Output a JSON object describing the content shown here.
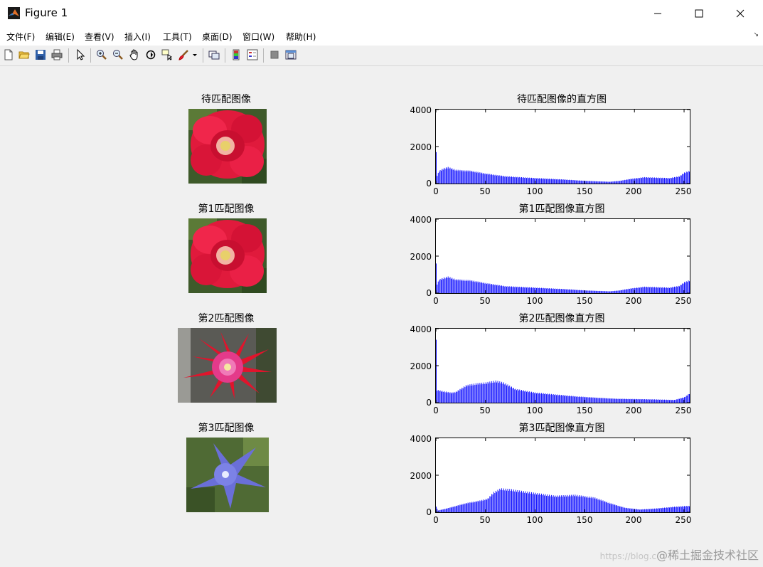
{
  "window": {
    "title": "Figure 1"
  },
  "menu": [
    "文件(F)",
    "编辑(E)",
    "查看(V)",
    "插入(I)",
    "工具(T)",
    "桌面(D)",
    "窗口(W)",
    "帮助(H)"
  ],
  "toolbar": [
    "new-figure-icon",
    "open-file-icon",
    "save-icon",
    "print-icon",
    "select-arrow-icon",
    "zoom-in-icon",
    "zoom-out-icon",
    "pan-hand-icon",
    "rotate-3d-icon",
    "data-cursor-icon",
    "brush-icon",
    "link-plot-icon",
    "colorbar-icon",
    "legend-icon",
    "hide-plot-tools-icon",
    "show-plot-tools-icon"
  ],
  "watermark": {
    "prefix": "https://blog.c",
    "text": "@稀土掘金技术社区"
  },
  "subplots": [
    {
      "image_title": "待匹配图像",
      "image_subject": "red-rose",
      "chart_data": {
        "type": "bar",
        "title": "待匹配图像的直方图",
        "xlabel": "",
        "ylabel": "",
        "xlim": [
          0,
          255
        ],
        "ylim": [
          0,
          4000
        ],
        "xticks": [
          0,
          50,
          100,
          150,
          200,
          250
        ],
        "yticks": [
          0,
          2000,
          4000
        ],
        "bar_color": "#0000ff",
        "profile": [
          [
            0,
            1700
          ],
          [
            1,
            450
          ],
          [
            3,
            700
          ],
          [
            8,
            850
          ],
          [
            12,
            900
          ],
          [
            20,
            750
          ],
          [
            35,
            700
          ],
          [
            50,
            550
          ],
          [
            70,
            400
          ],
          [
            100,
            300
          ],
          [
            130,
            220
          ],
          [
            150,
            150
          ],
          [
            175,
            100
          ],
          [
            185,
            150
          ],
          [
            195,
            250
          ],
          [
            210,
            350
          ],
          [
            235,
            300
          ],
          [
            245,
            400
          ],
          [
            250,
            600
          ],
          [
            255,
            700
          ]
        ]
      }
    },
    {
      "image_title": "第1匹配图像",
      "image_subject": "red-rose",
      "chart_data": {
        "type": "bar",
        "title": "第1匹配图像直方图",
        "xlabel": "",
        "ylabel": "",
        "xlim": [
          0,
          255
        ],
        "ylim": [
          0,
          4000
        ],
        "xticks": [
          0,
          50,
          100,
          150,
          200,
          250
        ],
        "yticks": [
          0,
          2000,
          4000
        ],
        "bar_color": "#0000ff",
        "profile": [
          [
            0,
            1600
          ],
          [
            1,
            500
          ],
          [
            3,
            750
          ],
          [
            8,
            850
          ],
          [
            12,
            900
          ],
          [
            20,
            750
          ],
          [
            35,
            700
          ],
          [
            50,
            550
          ],
          [
            70,
            380
          ],
          [
            100,
            300
          ],
          [
            130,
            220
          ],
          [
            150,
            150
          ],
          [
            175,
            100
          ],
          [
            185,
            150
          ],
          [
            195,
            250
          ],
          [
            210,
            350
          ],
          [
            235,
            300
          ],
          [
            245,
            400
          ],
          [
            250,
            600
          ],
          [
            255,
            700
          ]
        ]
      }
    },
    {
      "image_title": "第2匹配图像",
      "image_subject": "pink-cactus-flower",
      "chart_data": {
        "type": "bar",
        "title": "第2匹配图像直方图",
        "xlabel": "",
        "ylabel": "",
        "xlim": [
          0,
          255
        ],
        "ylim": [
          0,
          4000
        ],
        "xticks": [
          0,
          50,
          100,
          150,
          200,
          250
        ],
        "yticks": [
          0,
          2000,
          4000
        ],
        "bar_color": "#0000ff",
        "profile": [
          [
            0,
            3400
          ],
          [
            1,
            700
          ],
          [
            5,
            650
          ],
          [
            15,
            550
          ],
          [
            20,
            600
          ],
          [
            30,
            950
          ],
          [
            40,
            1050
          ],
          [
            50,
            1100
          ],
          [
            60,
            1200
          ],
          [
            68,
            1100
          ],
          [
            80,
            750
          ],
          [
            100,
            550
          ],
          [
            120,
            450
          ],
          [
            140,
            350
          ],
          [
            160,
            280
          ],
          [
            180,
            220
          ],
          [
            200,
            200
          ],
          [
            220,
            180
          ],
          [
            240,
            150
          ],
          [
            250,
            300
          ],
          [
            255,
            500
          ]
        ]
      }
    },
    {
      "image_title": "第3匹配图像",
      "image_subject": "blue-balloon-flower",
      "chart_data": {
        "type": "bar",
        "title": "第3匹配图像直方图",
        "xlabel": "",
        "ylabel": "",
        "xlim": [
          0,
          255
        ],
        "ylim": [
          0,
          4000
        ],
        "xticks": [
          0,
          50,
          100,
          150,
          200,
          250
        ],
        "yticks": [
          0,
          2000,
          4000
        ],
        "bar_color": "#0000ff",
        "profile": [
          [
            0,
            300
          ],
          [
            2,
            100
          ],
          [
            10,
            200
          ],
          [
            20,
            350
          ],
          [
            30,
            500
          ],
          [
            45,
            650
          ],
          [
            52,
            750
          ],
          [
            58,
            1100
          ],
          [
            65,
            1300
          ],
          [
            75,
            1250
          ],
          [
            100,
            1050
          ],
          [
            120,
            900
          ],
          [
            140,
            950
          ],
          [
            160,
            800
          ],
          [
            175,
            500
          ],
          [
            190,
            250
          ],
          [
            205,
            150
          ],
          [
            220,
            200
          ],
          [
            240,
            300
          ],
          [
            255,
            350
          ]
        ]
      }
    }
  ]
}
